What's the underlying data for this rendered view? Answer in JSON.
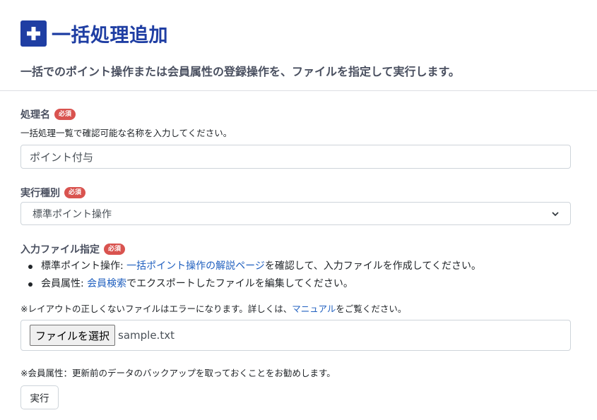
{
  "header": {
    "title": "一括処理追加",
    "subtitle": "一括でのポイント操作または会員属性の登録操作を、ファイルを指定して実行します。"
  },
  "colors": {
    "accent": "#1f3ea3",
    "required_badge": "#d9534f",
    "link": "#1f5fbf"
  },
  "icons": {
    "title_icon": "plus-square-icon",
    "select_icon": "chevron-down-icon"
  },
  "form": {
    "required_label": "必須",
    "name": {
      "label": "処理名",
      "help": "一括処理一覧で確認可能な名称を入力してください。",
      "value": "ポイント付与"
    },
    "type": {
      "label": "実行種別",
      "selected": "標準ポイント操作"
    },
    "file": {
      "label": "入力ファイル指定",
      "bullet1_prefix": "標準ポイント操作: ",
      "bullet1_link": "一括ポイント操作の解説ページ",
      "bullet1_suffix": "を確認して、入力ファイルを作成してください。",
      "bullet2_prefix": "会員属性: ",
      "bullet2_link": "会員検索",
      "bullet2_suffix": "でエクスポートしたファイルを編集してください。",
      "note_prefix": "※レイアウトの正しくないファイルはエラーになります。詳しくは、",
      "note_link": "マニュアル",
      "note_suffix": "をご覧ください。",
      "choose_button": "ファイルを選択",
      "file_name": "sample.txt"
    },
    "backup_note": "※会員属性：更新前のデータのバックアップを取っておくことをお勧めします。",
    "submit_label": "実行"
  }
}
